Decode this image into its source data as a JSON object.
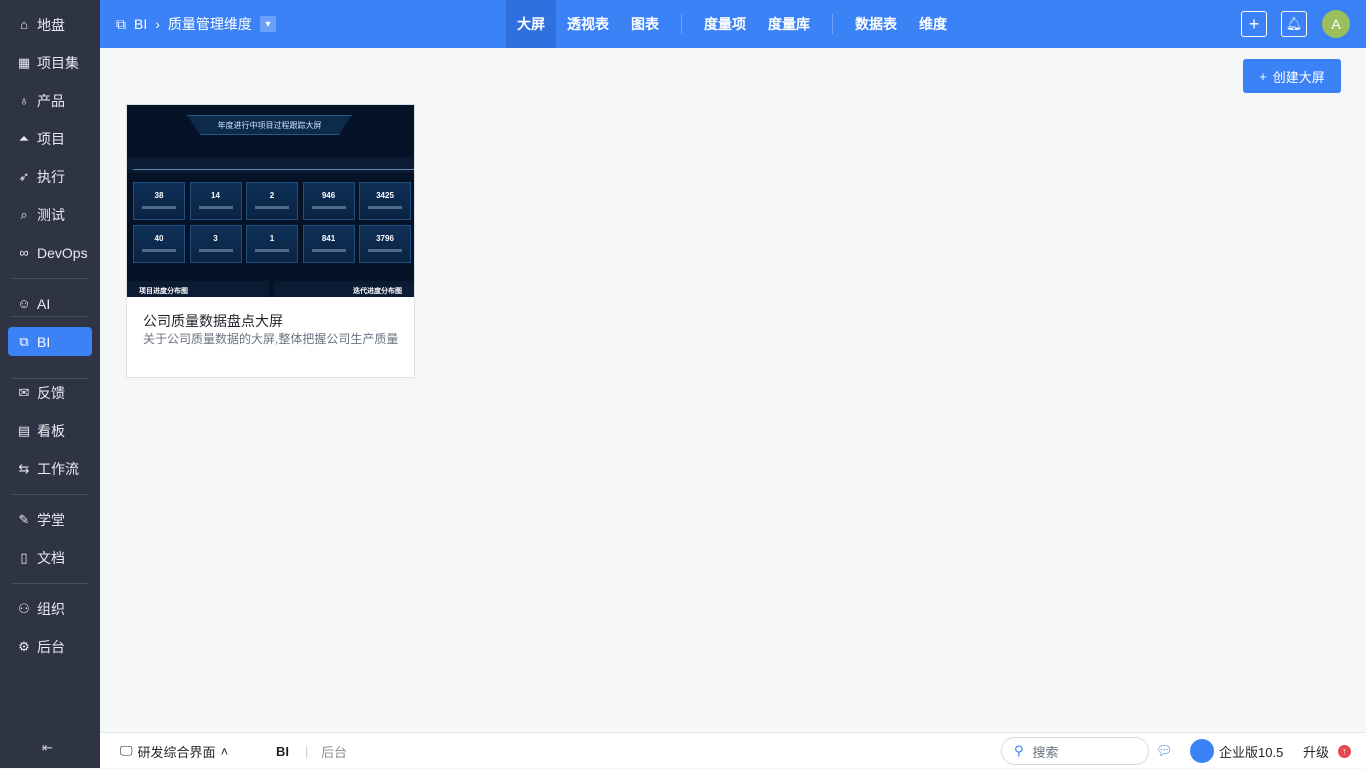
{
  "sidebar": {
    "items": [
      {
        "label": "地盘",
        "icon": "home-icon"
      },
      {
        "label": "项目集",
        "icon": "grid-icon"
      },
      {
        "label": "产品",
        "icon": "bulb-icon"
      },
      {
        "label": "项目",
        "icon": "rocket-icon"
      },
      {
        "label": "执行",
        "icon": "run-icon"
      },
      {
        "label": "测试",
        "icon": "test-icon"
      },
      {
        "label": "DevOps",
        "icon": "infinity-icon"
      },
      {
        "label": "AI",
        "icon": "robot-icon"
      },
      {
        "label": "BI",
        "icon": "chart-icon"
      },
      {
        "label": "反馈",
        "icon": "feedback-icon"
      },
      {
        "label": "看板",
        "icon": "kanban-icon"
      },
      {
        "label": "工作流",
        "icon": "workflow-icon"
      },
      {
        "label": "学堂",
        "icon": "school-icon"
      },
      {
        "label": "文档",
        "icon": "doc-icon"
      },
      {
        "label": "组织",
        "icon": "users-icon"
      },
      {
        "label": "后台",
        "icon": "gear-icon"
      }
    ],
    "collapse": "⇤"
  },
  "topbar": {
    "module": "BI",
    "dimension": "质量管理维度",
    "tabs": [
      "大屏",
      "透视表",
      "图表",
      "度量项",
      "度量库",
      "数据表",
      "维度"
    ],
    "avatar": "A"
  },
  "main": {
    "create_button": "创建大屏",
    "card": {
      "title": "公司质量数据盘点大屏",
      "description": "关于公司质量数据的大屏,整体把握公司生产质量",
      "thumbnail": {
        "title": "年度进行中项目过程跟踪大屏",
        "stats_row1": [
          "38",
          "14",
          "2",
          "946",
          "3425"
        ],
        "stats_row2": [
          "40",
          "3",
          "1",
          "841",
          "3796"
        ],
        "section_left": "项目进度分布图",
        "section_right": "迭代进度分布图"
      }
    }
  },
  "bottombar": {
    "app": "研发综合界面",
    "crumb1": "BI",
    "crumb2": "后台",
    "search_placeholder": "搜索",
    "edition": "企业版10.5",
    "upgrade": "升级"
  }
}
